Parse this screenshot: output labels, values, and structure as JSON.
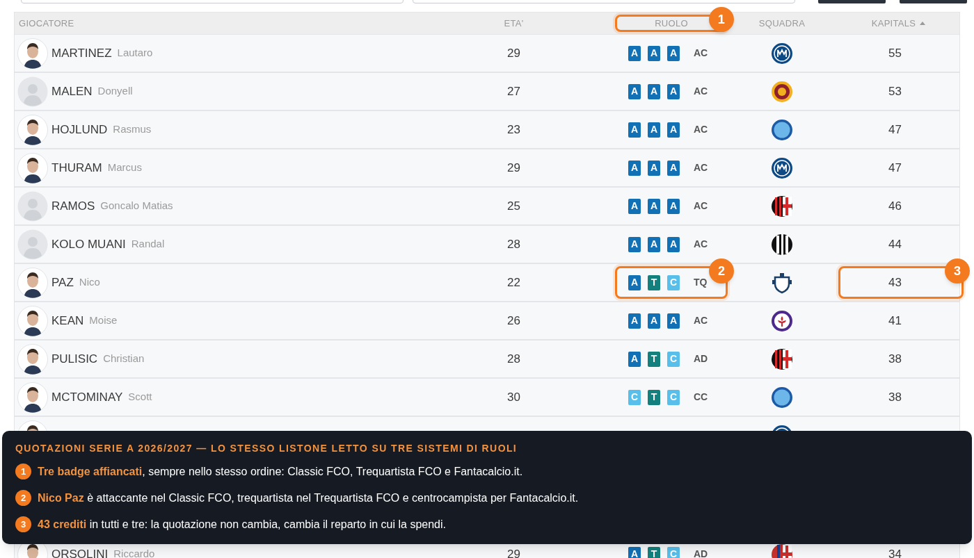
{
  "top_bar": {
    "fields": [
      {
        "kind": "wide"
      },
      {
        "kind": "wide"
      }
    ],
    "buttons": [
      {
        "kind": "dark"
      },
      {
        "kind": "dark"
      }
    ]
  },
  "table": {
    "columns": [
      {
        "label": "GIOCATORE"
      },
      {
        "label": "ETA'"
      },
      {
        "label": "RUOLO",
        "callout": "1"
      },
      {
        "label": "SQUADRA"
      },
      {
        "label": "KAPITALS",
        "sorted": true
      }
    ],
    "rows": [
      {
        "surname": "MARTINEZ",
        "name": "Lautaro",
        "avatar": {
          "kind": "photo"
        },
        "age": "29",
        "badges": [
          {
            "letter": "A",
            "color": "#1270b5"
          },
          {
            "letter": "A",
            "color": "#1270b5"
          },
          {
            "letter": "A",
            "color": "#1270b5"
          }
        ],
        "role": "AC",
        "team": {
          "kind": "inter"
        },
        "kapitals": "55"
      },
      {
        "surname": "MALEN",
        "name": "Donyell",
        "avatar": {
          "kind": "placeholder"
        },
        "age": "27",
        "badges": [
          {
            "letter": "A",
            "color": "#1270b5"
          },
          {
            "letter": "A",
            "color": "#1270b5"
          },
          {
            "letter": "A",
            "color": "#1270b5"
          }
        ],
        "role": "AC",
        "team": {
          "kind": "roma"
        },
        "kapitals": "53"
      },
      {
        "surname": "HOJLUND",
        "name": "Rasmus",
        "avatar": {
          "kind": "photo"
        },
        "age": "23",
        "badges": [
          {
            "letter": "A",
            "color": "#1270b5"
          },
          {
            "letter": "A",
            "color": "#1270b5"
          },
          {
            "letter": "A",
            "color": "#1270b5"
          }
        ],
        "role": "AC",
        "team": {
          "kind": "napoli"
        },
        "kapitals": "47"
      },
      {
        "surname": "THURAM",
        "name": "Marcus",
        "avatar": {
          "kind": "photo"
        },
        "age": "29",
        "badges": [
          {
            "letter": "A",
            "color": "#1270b5"
          },
          {
            "letter": "A",
            "color": "#1270b5"
          },
          {
            "letter": "A",
            "color": "#1270b5"
          }
        ],
        "role": "AC",
        "team": {
          "kind": "inter"
        },
        "kapitals": "47"
      },
      {
        "surname": "RAMOS",
        "name": "Goncalo Matias",
        "avatar": {
          "kind": "placeholder"
        },
        "age": "25",
        "badges": [
          {
            "letter": "A",
            "color": "#1270b5"
          },
          {
            "letter": "A",
            "color": "#1270b5"
          },
          {
            "letter": "A",
            "color": "#1270b5"
          }
        ],
        "role": "AC",
        "team": {
          "kind": "milan"
        },
        "kapitals": "46"
      },
      {
        "surname": "KOLO MUANI",
        "name": "Randal",
        "avatar": {
          "kind": "placeholder"
        },
        "age": "28",
        "badges": [
          {
            "letter": "A",
            "color": "#1270b5"
          },
          {
            "letter": "A",
            "color": "#1270b5"
          },
          {
            "letter": "A",
            "color": "#1270b5"
          }
        ],
        "role": "AC",
        "team": {
          "kind": "juventus"
        },
        "kapitals": "44"
      },
      {
        "surname": "PAZ",
        "name": "Nico",
        "avatar": {
          "kind": "photo"
        },
        "age": "22",
        "badges": [
          {
            "letter": "A",
            "color": "#1270b5"
          },
          {
            "letter": "T",
            "color": "#13807e"
          },
          {
            "letter": "C",
            "color": "#58bfea"
          }
        ],
        "role": "TQ",
        "team": {
          "kind": "como"
        },
        "kapitals": "43",
        "role_callout": "2",
        "kapitals_callout": "3"
      },
      {
        "surname": "KEAN",
        "name": "Moise",
        "avatar": {
          "kind": "photo"
        },
        "age": "26",
        "badges": [
          {
            "letter": "A",
            "color": "#1270b5"
          },
          {
            "letter": "A",
            "color": "#1270b5"
          },
          {
            "letter": "A",
            "color": "#1270b5"
          }
        ],
        "role": "AC",
        "team": {
          "kind": "fiorentina"
        },
        "kapitals": "41"
      },
      {
        "surname": "PULISIC",
        "name": "Christian",
        "avatar": {
          "kind": "photo"
        },
        "age": "28",
        "badges": [
          {
            "letter": "A",
            "color": "#1270b5"
          },
          {
            "letter": "T",
            "color": "#13807e"
          },
          {
            "letter": "C",
            "color": "#58bfea"
          }
        ],
        "role": "AD",
        "team": {
          "kind": "milan"
        },
        "kapitals": "38"
      },
      {
        "surname": "MCTOMINAY",
        "name": "Scott",
        "avatar": {
          "kind": "photo"
        },
        "age": "30",
        "badges": [
          {
            "letter": "C",
            "color": "#58bfea"
          },
          {
            "letter": "T",
            "color": "#13807e"
          },
          {
            "letter": "C",
            "color": "#58bfea"
          }
        ],
        "role": "CC",
        "team": {
          "kind": "napoli"
        },
        "kapitals": "38"
      },
      {
        "avatar": {
          "kind": "photo"
        },
        "team": {
          "kind": "inter"
        }
      },
      {
        "surname": "ORSOLINI",
        "name": "Riccardo",
        "avatar": {
          "kind": "photo"
        },
        "age": "29",
        "badges": [
          {
            "letter": "A",
            "color": "#1270b5"
          },
          {
            "letter": "T",
            "color": "#13807e"
          },
          {
            "letter": "C",
            "color": "#58bfea"
          }
        ],
        "role": "AD",
        "team": {
          "kind": "bologna"
        },
        "kapitals": "34"
      }
    ]
  },
  "legend": {
    "title": "QUOTAZIONI SERIE A 2026/2027 — LO STESSO LISTONE LETTO SU TRE SISTEMI DI RUOLI",
    "items": [
      {
        "number": "1",
        "text": "**Tre badge affiancati**, sempre nello stesso ordine: Classic FCO, Trequartista FCO e Fantacalcio.it."
      },
      {
        "number": "2",
        "text": "**Nico Paz** è attaccante nel Classic FCO, trequartista nel Trequartista FCO e centrocampista per Fantacalcio.it."
      },
      {
        "number": "3",
        "text": "**43 crediti** in tutti e tre: la quotazione non cambia, cambia il reparto in cui la spendi."
      }
    ]
  }
}
